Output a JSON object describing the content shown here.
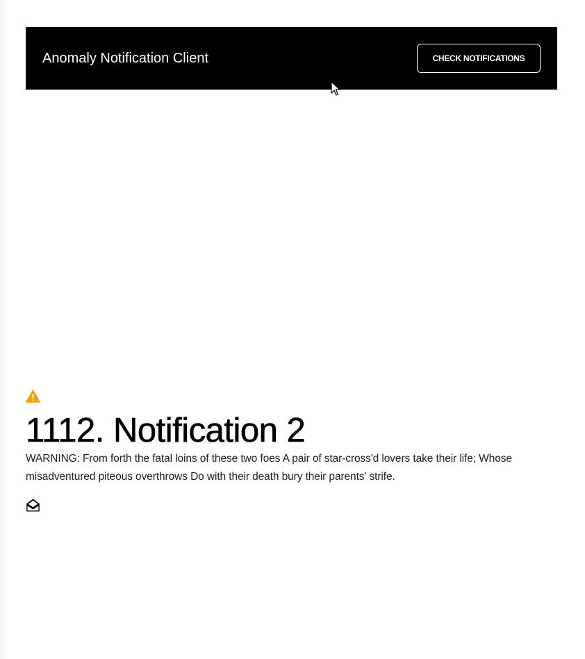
{
  "header": {
    "title": "Anomaly Notification Client",
    "check_button_label": "CHECK NOTIFICATIONS"
  },
  "notification": {
    "status_icon": "warning-triangle-icon",
    "status_color": "#F6A100",
    "title": "1112. Notification 2",
    "body": "WARNING: From forth the fatal loins of these two foes A pair of star-cross'd lovers take their life; Whose misadventured piteous overthrows Do with their death bury their parents' strife.",
    "read_icon": "envelope-open-icon"
  },
  "colors": {
    "app_bar_background": "#000000",
    "page_background": "#FFFFFF",
    "warning_accent": "#F6A100"
  }
}
